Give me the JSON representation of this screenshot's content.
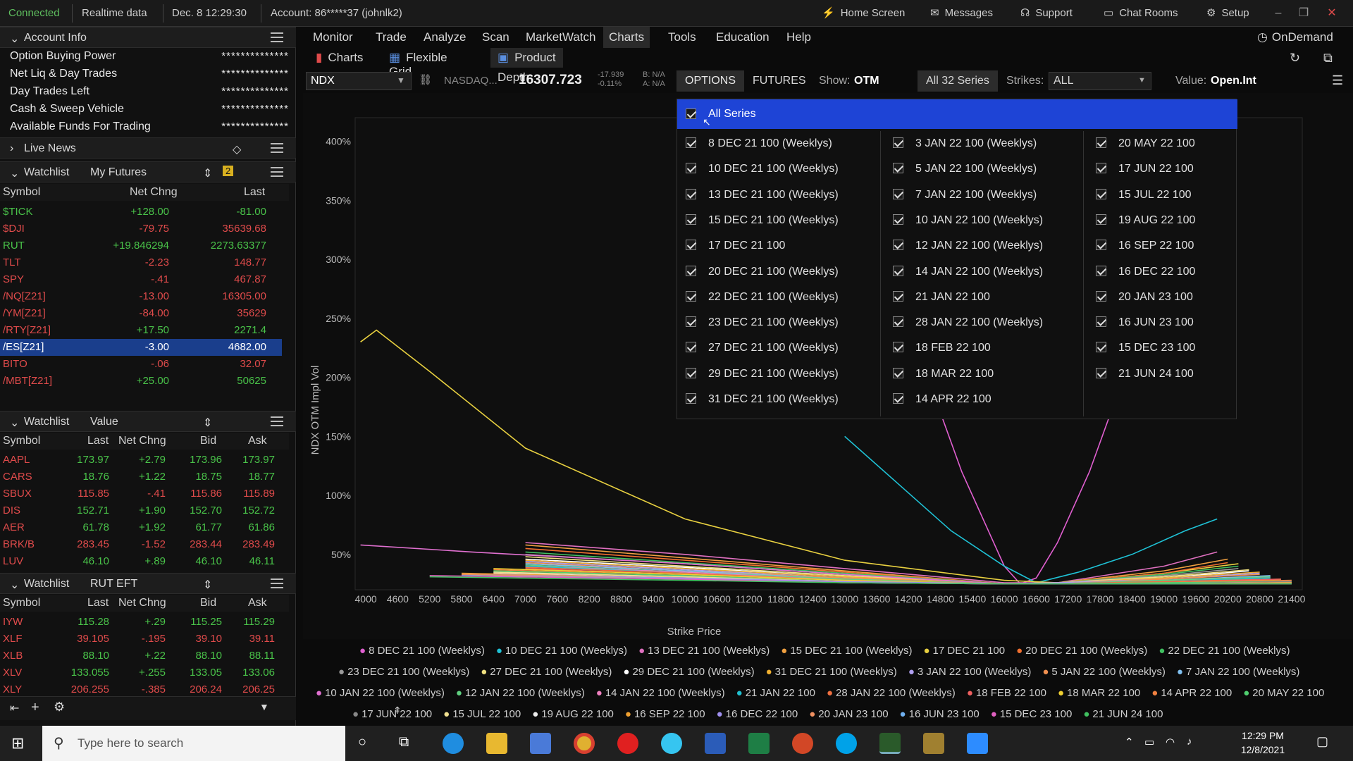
{
  "topbar": {
    "connected": "Connected",
    "realtime": "Realtime data",
    "datetime": "Dec. 8  12:29:30",
    "account": "Account: 86*****37 (johnlk2)",
    "home_screen": "Home Screen",
    "messages": "Messages",
    "support": "Support",
    "chat_rooms": "Chat Rooms",
    "setup": "Setup"
  },
  "account_info": {
    "title": "Account Info",
    "rows": [
      {
        "label": "Option Buying Power",
        "value": "**************"
      },
      {
        "label": "Net Liq & Day Trades",
        "value": "**************"
      },
      {
        "label": "Day Trades Left",
        "value": "**************"
      },
      {
        "label": "Cash & Sweep Vehicle",
        "value": "**************"
      },
      {
        "label": "Available Funds For Trading",
        "value": "**************"
      }
    ]
  },
  "live_news": {
    "title": "Live News"
  },
  "watchlist1": {
    "title": "Watchlist",
    "name": "My Futures",
    "badge": "2",
    "cols": [
      "Symbol",
      "Net Chng",
      "Last"
    ],
    "rows": [
      {
        "sym": "$TICK",
        "chg": "+128.00",
        "last": "-81.00"
      },
      {
        "sym": "$DJI",
        "chg": "-79.75",
        "last": "35639.68"
      },
      {
        "sym": "RUT",
        "chg": "+19.846294",
        "last": "2273.63377"
      },
      {
        "sym": "TLT",
        "chg": "-2.23",
        "last": "148.77"
      },
      {
        "sym": "SPY",
        "chg": "-.41",
        "last": "467.87"
      },
      {
        "sym": "/NQ[Z21]",
        "chg": "-13.00",
        "last": "16305.00"
      },
      {
        "sym": "/YM[Z21]",
        "chg": "-84.00",
        "last": "35629"
      },
      {
        "sym": "/RTY[Z21]",
        "chg": "+17.50",
        "last": "2271.4"
      },
      {
        "sym": "/ES[Z21]",
        "chg": "-3.00",
        "last": "4682.00"
      },
      {
        "sym": "BITO",
        "chg": "-.06",
        "last": "32.07"
      },
      {
        "sym": "/MBT[Z21]",
        "chg": "+25.00",
        "last": "50625"
      }
    ]
  },
  "watchlist2": {
    "title": "Watchlist",
    "name": "Value",
    "cols": [
      "Symbol",
      "Last",
      "Net Chng",
      "Bid",
      "Ask"
    ],
    "rows": [
      {
        "sym": "AAPL",
        "last": "173.97",
        "chg": "+2.79",
        "bid": "173.96",
        "ask": "173.97"
      },
      {
        "sym": "CARS",
        "last": "18.76",
        "chg": "+1.22",
        "bid": "18.75",
        "ask": "18.77"
      },
      {
        "sym": "SBUX",
        "last": "115.85",
        "chg": "-.41",
        "bid": "115.86",
        "ask": "115.89"
      },
      {
        "sym": "DIS",
        "last": "152.71",
        "chg": "+1.90",
        "bid": "152.70",
        "ask": "152.72"
      },
      {
        "sym": "AER",
        "last": "61.78",
        "chg": "+1.92",
        "bid": "61.77",
        "ask": "61.86"
      },
      {
        "sym": "BRK/B",
        "last": "283.45",
        "chg": "-1.52",
        "bid": "283.44",
        "ask": "283.49"
      },
      {
        "sym": "LUV",
        "last": "46.10",
        "chg": "+.89",
        "bid": "46.10",
        "ask": "46.11"
      }
    ]
  },
  "watchlist3": {
    "title": "Watchlist",
    "name": "RUT EFT",
    "cols": [
      "Symbol",
      "Last",
      "Net Chng",
      "Bid",
      "Ask"
    ],
    "rows": [
      {
        "sym": "IYW",
        "last": "115.28",
        "chg": "+.29",
        "bid": "115.25",
        "ask": "115.29"
      },
      {
        "sym": "XLF",
        "last": "39.105",
        "chg": "-.195",
        "bid": "39.10",
        "ask": "39.11"
      },
      {
        "sym": "XLB",
        "last": "88.10",
        "chg": "+.22",
        "bid": "88.10",
        "ask": "88.11"
      },
      {
        "sym": "XLV",
        "last": "133.055",
        "chg": "+.255",
        "bid": "133.05",
        "ask": "133.06"
      },
      {
        "sym": "XLY",
        "last": "206.255",
        "chg": "-.385",
        "bid": "206.24",
        "ask": "206.25"
      }
    ]
  },
  "menu": [
    "Monitor",
    "Trade",
    "Analyze",
    "Scan",
    "MarketWatch",
    "Charts",
    "Tools",
    "Education",
    "Help"
  ],
  "ondemand": "OnDemand",
  "subtabs": [
    "Charts",
    "Flexible Grid",
    "Product Depth"
  ],
  "controls": {
    "symbol": "NDX",
    "exchange": "NASDAQ...",
    "price": "16307.723",
    "chg_top": "-17.939",
    "chg_bot": "-0.11%",
    "bid": "B: N/A",
    "ask": "A: N/A",
    "options": "OPTIONS",
    "futures": "FUTURES",
    "show_label": "Show:",
    "show_value": "OTM",
    "series": "All 32 Series",
    "strikes_label": "Strikes:",
    "strikes_value": "ALL",
    "value_label": "Value:",
    "value_value": "Open.Int"
  },
  "dropdown": {
    "all": "All Series",
    "col1": [
      "8 DEC 21 100 (Weeklys)",
      "10 DEC 21 100 (Weeklys)",
      "13 DEC 21 100 (Weeklys)",
      "15 DEC 21 100 (Weeklys)",
      "17 DEC 21 100",
      "20 DEC 21 100 (Weeklys)",
      "22 DEC 21 100 (Weeklys)",
      "23 DEC 21 100 (Weeklys)",
      "27 DEC 21 100 (Weeklys)",
      "29 DEC 21 100 (Weeklys)",
      "31 DEC 21 100 (Weeklys)"
    ],
    "col2": [
      "3 JAN 22 100 (Weeklys)",
      "5 JAN 22 100 (Weeklys)",
      "7 JAN 22 100 (Weeklys)",
      "10 JAN 22 100 (Weeklys)",
      "12 JAN 22 100 (Weeklys)",
      "14 JAN 22 100 (Weeklys)",
      "21 JAN 22 100",
      "28 JAN 22 100 (Weeklys)",
      "18 FEB 22 100",
      "18 MAR 22 100",
      "14 APR 22 100"
    ],
    "col3": [
      "20 MAY 22 100",
      "17 JUN 22 100",
      "15 JUL 22 100",
      "19 AUG 22 100",
      "16 SEP 22 100",
      "16 DEC 22 100",
      "20 JAN 23 100",
      "16 JUN 23 100",
      "15 DEC 23 100",
      "21 JUN 24 100"
    ]
  },
  "chart_data": {
    "type": "line",
    "ylabel": "NDX OTM Impl Vol",
    "xlabel": "Strike Price",
    "yticks": [
      "400%",
      "350%",
      "300%",
      "250%",
      "200%",
      "150%",
      "100%",
      "50%"
    ],
    "xticks": [
      "4000",
      "4600",
      "5200",
      "5800",
      "6400",
      "7000",
      "7600",
      "8200",
      "8800",
      "9400",
      "10000",
      "10600",
      "11200",
      "11800",
      "12400",
      "13000",
      "13600",
      "14200",
      "14800",
      "15400",
      "16000",
      "16600",
      "17200",
      "17800",
      "18400",
      "19000",
      "19600",
      "20200",
      "20800",
      "21400"
    ],
    "xlim": [
      3800,
      21600
    ],
    "ylim": [
      20,
      420
    ],
    "series": [
      {
        "name": "8 DEC 21 100 (Weeklys)",
        "color": "#e05fd0",
        "x": [
          14800,
          15200,
          15600,
          16000,
          16300,
          16600,
          17000,
          17600,
          18000
        ],
        "y": [
          170,
          120,
          80,
          40,
          25,
          30,
          60,
          120,
          170
        ]
      },
      {
        "name": "10 DEC 21 100 (Weeklys)",
        "color": "#1fc2d6",
        "x": [
          13000,
          14000,
          15000,
          16000,
          16600,
          17400,
          18400,
          19400,
          20000
        ],
        "y": [
          150,
          110,
          70,
          40,
          26,
          35,
          50,
          70,
          80
        ]
      },
      {
        "name": "13 DEC 21 100 (Weeklys)",
        "color": "#e070c0",
        "x": [
          7000,
          10000,
          13000,
          16000,
          17000,
          19000,
          20000
        ],
        "y": [
          60,
          50,
          38,
          26,
          26,
          40,
          52
        ]
      },
      {
        "name": "15 DEC 21 100 (Weeklys)",
        "color": "#f0a040",
        "x": [
          7000,
          10000,
          13000,
          16000,
          17000,
          19000,
          20200
        ],
        "y": [
          58,
          47,
          36,
          25,
          26,
          36,
          46
        ]
      },
      {
        "name": "17 DEC 21 100",
        "color": "#e8d040",
        "x": [
          3900,
          4200,
          5200,
          7000,
          10000,
          13000,
          16000,
          17000,
          19000,
          20400
        ],
        "y": [
          230,
          240,
          205,
          140,
          80,
          45,
          28,
          26,
          34,
          42
        ]
      },
      {
        "name": "20 DEC 21 100 (Weeklys)",
        "color": "#f07030",
        "x": [
          7000,
          10000,
          13000,
          16000,
          17000,
          19000,
          20200
        ],
        "y": [
          55,
          45,
          35,
          25,
          26,
          34,
          43
        ]
      },
      {
        "name": "22 DEC 21 100 (Weeklys)",
        "color": "#40c060",
        "x": [
          7000,
          10000,
          13000,
          16000,
          17000,
          19000,
          20400
        ],
        "y": [
          52,
          43,
          34,
          25,
          26,
          33,
          40
        ]
      },
      {
        "name": "23 DEC 21 100 (Weeklys)",
        "color": "#999999",
        "x": [
          7000,
          10000,
          13000,
          16000,
          17000,
          19000,
          20400
        ],
        "y": [
          50,
          42,
          33,
          25,
          26,
          32,
          38
        ]
      },
      {
        "name": "27 DEC 21 100 (Weeklys)",
        "color": "#f0e080",
        "x": [
          7000,
          10000,
          13000,
          16000,
          17000,
          19000,
          20600
        ],
        "y": [
          48,
          40,
          32,
          25,
          26,
          31,
          37
        ]
      },
      {
        "name": "29 DEC 21 100 (Weeklys)",
        "color": "#ffffff",
        "x": [
          7000,
          10000,
          13000,
          16000,
          17000,
          19000,
          20600
        ],
        "y": [
          46,
          39,
          31,
          25,
          26,
          30,
          36
        ]
      },
      {
        "name": "31 DEC 21 100 (Weeklys)",
        "color": "#f0b030",
        "x": [
          7000,
          10000,
          13000,
          16000,
          17000,
          19000,
          20800
        ],
        "y": [
          45,
          38,
          31,
          25,
          26,
          30,
          35
        ]
      },
      {
        "name": "3 JAN 22 100 (Weeklys)",
        "color": "#b0a0f0",
        "x": [
          7000,
          10000,
          13000,
          16000,
          17000,
          19000,
          20800
        ],
        "y": [
          44,
          37,
          30,
          25,
          26,
          29,
          34
        ]
      },
      {
        "name": "5 JAN 22 100 (Weeklys)",
        "color": "#f09050",
        "x": [
          7000,
          10000,
          13000,
          16000,
          17000,
          19000,
          20800
        ],
        "y": [
          43,
          36,
          30,
          25,
          25,
          29,
          33
        ]
      },
      {
        "name": "7 JAN 22 100 (Weeklys)",
        "color": "#80c0f0",
        "x": [
          7000,
          10000,
          13000,
          16000,
          17000,
          19000,
          21000
        ],
        "y": [
          42,
          36,
          29,
          25,
          25,
          28,
          32
        ]
      },
      {
        "name": "10 JAN 22 100 (Weeklys)",
        "color": "#e070d0",
        "x": [
          3900,
          6000,
          10000,
          13000,
          16000,
          17000,
          19000,
          21000
        ],
        "y": [
          58,
          52,
          42,
          33,
          25,
          25,
          28,
          31
        ]
      },
      {
        "name": "12 JAN 22 100 (Weeklys)",
        "color": "#60d080",
        "x": [
          7000,
          10000,
          13000,
          16000,
          17000,
          19000,
          21000
        ],
        "y": [
          41,
          35,
          29,
          25,
          25,
          28,
          31
        ]
      },
      {
        "name": "14 JAN 22 100 (Weeklys)",
        "color": "#f080c0",
        "x": [
          7000,
          10000,
          13000,
          16000,
          17000,
          19000,
          21000
        ],
        "y": [
          40,
          35,
          28,
          25,
          25,
          27,
          30
        ]
      },
      {
        "name": "21 JAN 22 100",
        "color": "#20c0d0",
        "x": [
          7000,
          10000,
          13000,
          16000,
          17000,
          19000,
          21000
        ],
        "y": [
          40,
          34,
          28,
          25,
          25,
          27,
          30
        ]
      },
      {
        "name": "28 JAN 22 100 (Weeklys)",
        "color": "#f07040",
        "x": [
          7000,
          10000,
          13000,
          16000,
          17000,
          19000,
          21200
        ],
        "y": [
          39,
          34,
          28,
          25,
          25,
          27,
          29
        ]
      },
      {
        "name": "18 FEB 22 100",
        "color": "#f06060",
        "x": [
          7000,
          10000,
          13000,
          16000,
          17000,
          19000,
          21200
        ],
        "y": [
          38,
          33,
          28,
          25,
          25,
          26,
          29
        ]
      },
      {
        "name": "18 MAR 22 100",
        "color": "#f0d030",
        "x": [
          6400,
          10000,
          13000,
          16000,
          17000,
          19000,
          21200
        ],
        "y": [
          38,
          33,
          28,
          25,
          25,
          26,
          28
        ]
      },
      {
        "name": "14 APR 22 100",
        "color": "#f08040",
        "x": [
          6400,
          10000,
          13000,
          16000,
          17000,
          19000,
          21400
        ],
        "y": [
          37,
          32,
          27,
          25,
          25,
          26,
          28
        ]
      },
      {
        "name": "20 MAY 22 100",
        "color": "#50d070",
        "x": [
          6400,
          10000,
          13000,
          16000,
          17000,
          19000,
          21400
        ],
        "y": [
          36,
          32,
          27,
          25,
          25,
          26,
          27
        ]
      },
      {
        "name": "17 JUN 22 100",
        "color": "#888888",
        "x": [
          6400,
          10000,
          13000,
          16000,
          17000,
          19000,
          21400
        ],
        "y": [
          35,
          31,
          27,
          25,
          25,
          25,
          27
        ]
      },
      {
        "name": "15 JUL 22 100",
        "color": "#f0e090",
        "x": [
          6400,
          10000,
          13000,
          16000,
          17000,
          19000,
          21400
        ],
        "y": [
          35,
          31,
          27,
          25,
          25,
          25,
          26
        ]
      },
      {
        "name": "19 AUG 22 100",
        "color": "#eeeeee",
        "x": [
          6400,
          10000,
          13000,
          16000,
          17000,
          19000,
          21400
        ],
        "y": [
          34,
          30,
          27,
          25,
          25,
          25,
          26
        ]
      },
      {
        "name": "16 SEP 22 100",
        "color": "#f0a030",
        "x": [
          5800,
          10000,
          13000,
          16000,
          17000,
          19000,
          21400
        ],
        "y": [
          34,
          30,
          27,
          25,
          25,
          25,
          26
        ]
      },
      {
        "name": "16 DEC 22 100",
        "color": "#a090f0",
        "x": [
          5800,
          10000,
          13000,
          16000,
          17000,
          19000,
          21400
        ],
        "y": [
          33,
          30,
          27,
          25,
          25,
          25,
          25
        ]
      },
      {
        "name": "20 JAN 23 100",
        "color": "#f09060",
        "x": [
          5800,
          10000,
          13000,
          16000,
          17000,
          19000,
          21400
        ],
        "y": [
          33,
          29,
          26,
          25,
          25,
          25,
          25
        ]
      },
      {
        "name": "16 JUN 23 100",
        "color": "#70b0f0",
        "x": [
          5800,
          10000,
          13000,
          16000,
          17000,
          19000,
          21400
        ],
        "y": [
          32,
          29,
          26,
          25,
          25,
          25,
          25
        ]
      },
      {
        "name": "15 DEC 23 100",
        "color": "#e060c0",
        "x": [
          5200,
          10000,
          13000,
          16000,
          17000,
          19000,
          21400
        ],
        "y": [
          32,
          29,
          26,
          25,
          25,
          25,
          25
        ]
      },
      {
        "name": "21 JUN 24 100",
        "color": "#40c060",
        "x": [
          5200,
          10000,
          13000,
          16000,
          17000,
          19000,
          21400
        ],
        "y": [
          31,
          28,
          26,
          25,
          25,
          25,
          25
        ]
      }
    ]
  },
  "taskbar": {
    "search_placeholder": "Type here to search",
    "time": "12:29 PM",
    "date": "12/8/2021"
  }
}
